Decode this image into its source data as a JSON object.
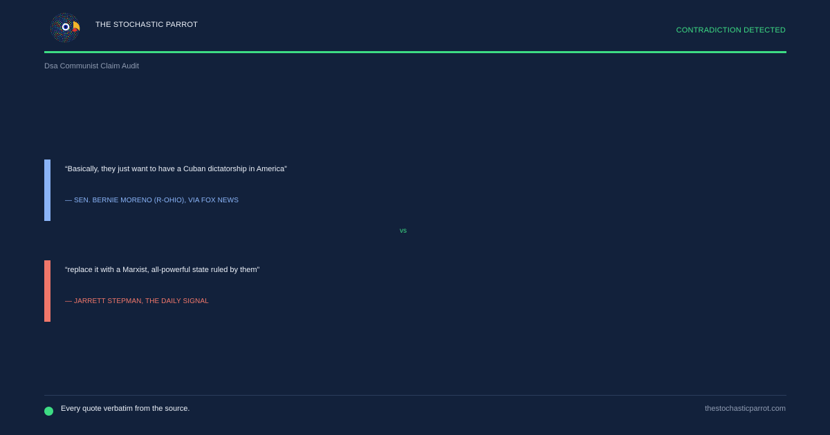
{
  "header": {
    "brand": "THE STOCHASTIC PARROT",
    "status": "CONTRADICTION DETECTED",
    "subtitle": "Dsa Communist Claim Audit",
    "logo_icon": "parrot-logo-icon"
  },
  "quotes": [
    {
      "text": "“Basically, they just want to have a Cuban dictatorship in America”",
      "attribution": "— SEN. BERNIE MORENO (R-OHIO), VIA FOX NEWS",
      "color": "#8ab4f8"
    },
    {
      "text": "“replace it with a Marxist, all-powerful state ruled by them”",
      "attribution": "— JARRETT STEPMAN, THE DAILY SIGNAL",
      "color": "#f0776a"
    }
  ],
  "separator": "vs",
  "footer": {
    "note": "Every quote verbatim from the source.",
    "site": "thestochasticparrot.com"
  },
  "colors": {
    "background": "#12213b",
    "accent": "#3ddc84",
    "quote_1": "#8ab4f8",
    "quote_2": "#f0776a",
    "muted": "#8e9ab0"
  }
}
